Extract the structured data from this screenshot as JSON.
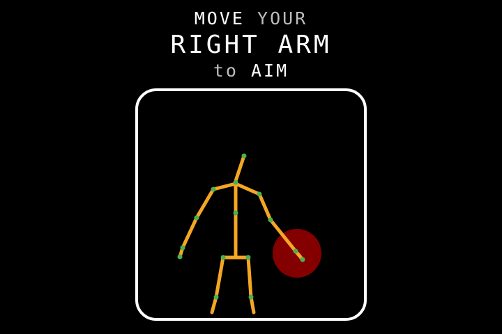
{
  "instruction": {
    "line1_word1": "MOVE",
    "line1_word2": "YOUR",
    "line2": "RIGHT ARM",
    "line3_word1": "to",
    "line3_word2": "AIM"
  },
  "colors": {
    "background": "#000000",
    "frame": "#ffffff",
    "bone": "#f5a623",
    "joint": "#4caf50",
    "target": "#8b0000"
  },
  "icons": {
    "skeleton": "stick-figure-icon",
    "target": "aim-target-icon"
  }
}
